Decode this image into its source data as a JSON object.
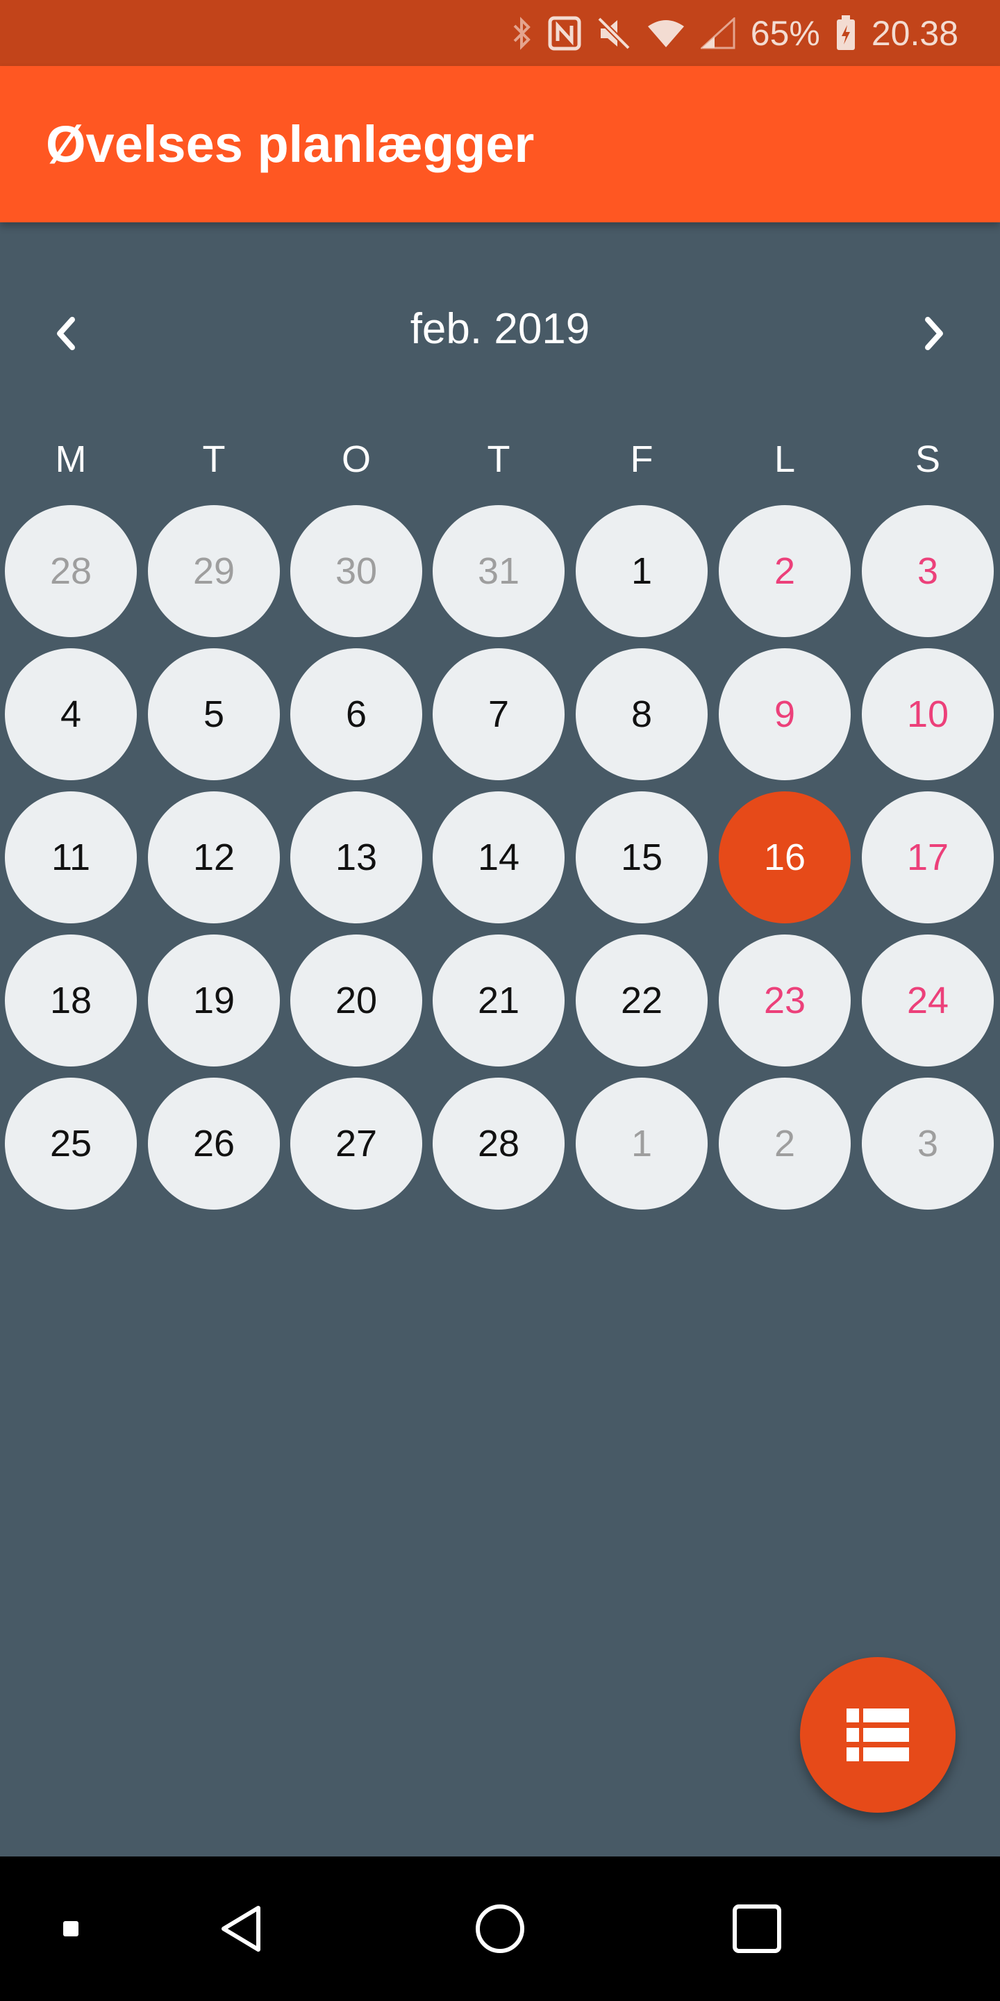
{
  "status_bar": {
    "battery_text": "65%",
    "time": "20.38",
    "icons": [
      "bluetooth-icon",
      "nfc-icon",
      "mute-icon",
      "wifi-icon",
      "signal-icon",
      "battery-icon"
    ]
  },
  "app_bar": {
    "title": "Øvelses planlægger"
  },
  "calendar": {
    "month_label": "feb. 2019",
    "prev_icon": "chevron-left-icon",
    "next_icon": "chevron-right-icon",
    "weekdays": [
      "M",
      "T",
      "O",
      "T",
      "F",
      "L",
      "S"
    ],
    "weeks": [
      [
        {
          "label": "28",
          "type": "other"
        },
        {
          "label": "29",
          "type": "other"
        },
        {
          "label": "30",
          "type": "other"
        },
        {
          "label": "31",
          "type": "other"
        },
        {
          "label": "1",
          "type": "normal"
        },
        {
          "label": "2",
          "type": "weekend"
        },
        {
          "label": "3",
          "type": "weekend"
        }
      ],
      [
        {
          "label": "4",
          "type": "normal"
        },
        {
          "label": "5",
          "type": "normal"
        },
        {
          "label": "6",
          "type": "normal"
        },
        {
          "label": "7",
          "type": "normal"
        },
        {
          "label": "8",
          "type": "normal"
        },
        {
          "label": "9",
          "type": "weekend"
        },
        {
          "label": "10",
          "type": "weekend"
        }
      ],
      [
        {
          "label": "11",
          "type": "normal"
        },
        {
          "label": "12",
          "type": "normal"
        },
        {
          "label": "13",
          "type": "normal"
        },
        {
          "label": "14",
          "type": "normal"
        },
        {
          "label": "15",
          "type": "normal"
        },
        {
          "label": "16",
          "type": "selected"
        },
        {
          "label": "17",
          "type": "weekend"
        }
      ],
      [
        {
          "label": "18",
          "type": "normal"
        },
        {
          "label": "19",
          "type": "normal"
        },
        {
          "label": "20",
          "type": "normal"
        },
        {
          "label": "21",
          "type": "normal"
        },
        {
          "label": "22",
          "type": "normal"
        },
        {
          "label": "23",
          "type": "weekend"
        },
        {
          "label": "24",
          "type": "weekend"
        }
      ],
      [
        {
          "label": "25",
          "type": "normal"
        },
        {
          "label": "26",
          "type": "normal"
        },
        {
          "label": "27",
          "type": "normal"
        },
        {
          "label": "28",
          "type": "normal"
        },
        {
          "label": "1",
          "type": "other"
        },
        {
          "label": "2",
          "type": "other"
        },
        {
          "label": "3",
          "type": "other"
        }
      ]
    ]
  },
  "fab": {
    "icon": "list-view-icon"
  },
  "nav_bar": {
    "icons": [
      "recent-dot-icon",
      "back-icon",
      "home-icon",
      "overview-icon"
    ]
  },
  "colors": {
    "status_bar": "#c2441a",
    "app_bar": "#ff5722",
    "background": "#485a66",
    "day_bg": "#eceff1",
    "selected": "#e64a19",
    "weekend_text": "#ec407a",
    "other_month_text": "#9e9e9e"
  }
}
